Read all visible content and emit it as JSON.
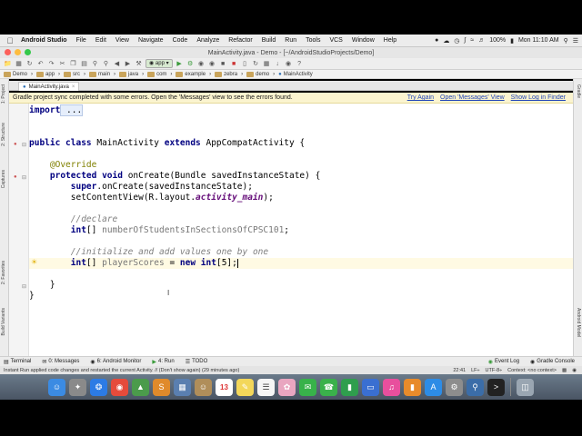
{
  "menubar": {
    "app": "Android Studio",
    "menus": [
      "File",
      "Edit",
      "View",
      "Navigate",
      "Code",
      "Analyze",
      "Refactor",
      "Build",
      "Run",
      "Tools",
      "VCS",
      "Window",
      "Help"
    ],
    "battery": "100%",
    "clock": "Mon 11:10 AM"
  },
  "window": {
    "title": "MainActivity.java - Demo - [~/AndroidStudioProjects/Demo]"
  },
  "toolbar": {
    "run_config": "app"
  },
  "breadcrumb": [
    "Demo",
    "app",
    "src",
    "main",
    "java",
    "com",
    "example",
    "zebra",
    "demo",
    "MainActivity"
  ],
  "tabs": [
    {
      "label": "MainActivity.java"
    }
  ],
  "notification": {
    "message": "Gradle project sync completed with some errors. Open the 'Messages' view to see the errors found.",
    "links": [
      "Try Again",
      "Open 'Messages' View",
      "Show Log in Finder"
    ]
  },
  "left_tools": [
    "1: Project",
    "2: Structure",
    "Captures",
    "2: Favorites",
    "Build Variants"
  ],
  "right_tools": [
    "Gradle",
    "Android Model"
  ],
  "code": {
    "l1_kw": "import",
    "l1_rest": " ...",
    "l2_kw1": "public class",
    "l2_name": " MainActivity ",
    "l2_kw2": "extends",
    "l2_rest": " AppCompatActivity {",
    "l3": "@Override",
    "l4_kw": "protected void",
    "l4_rest": " onCreate(Bundle savedInstanceState) {",
    "l5_kw": "super",
    "l5_rest": ".onCreate(savedInstanceState);",
    "l6_a": "setContentView(R.layout.",
    "l6_b": "activity_main",
    "l6_c": ");",
    "l7": "//declare",
    "l8_kw": "int",
    "l8_rest": "[] ",
    "l8_var": "numberOfStudentsInSectionsOfCPSC101",
    "l8_end": ";",
    "l9": "//initialize and add values one by one",
    "l10_kw": "int",
    "l10_a": "[] ",
    "l10_var": "playerScores",
    "l10_b": " = ",
    "l10_kw2": "new int",
    "l10_c": "[5];",
    "l11": "}",
    "l12": "}"
  },
  "bottom_tools": [
    "Terminal",
    "0: Messages",
    "6: Android Monitor",
    "4: Run",
    "TODO"
  ],
  "bottom_right": [
    "Event Log",
    "Gradle Console"
  ],
  "status": {
    "message": "Instant Run applied code changes and restarted the current Activity. // (Don't show again) (29 minutes ago)",
    "position": "22:41",
    "line_sep": "LF÷",
    "encoding": "UTF-8÷",
    "context": "Context: <no context>"
  },
  "dock_apps": [
    "Finder",
    "Launchpad",
    "Safari",
    "Chrome",
    "Android Studio",
    "Sublime",
    "Preview",
    "Contacts",
    "Calendar",
    "Notes",
    "Reminders",
    "Photos",
    "Messages",
    "FaceTime",
    "Numbers",
    "Keynote",
    "iTunes",
    "iBooks",
    "App Store",
    "System Preferences",
    "Network Utility",
    "Terminal",
    "Trash"
  ],
  "calendar_day": "13"
}
